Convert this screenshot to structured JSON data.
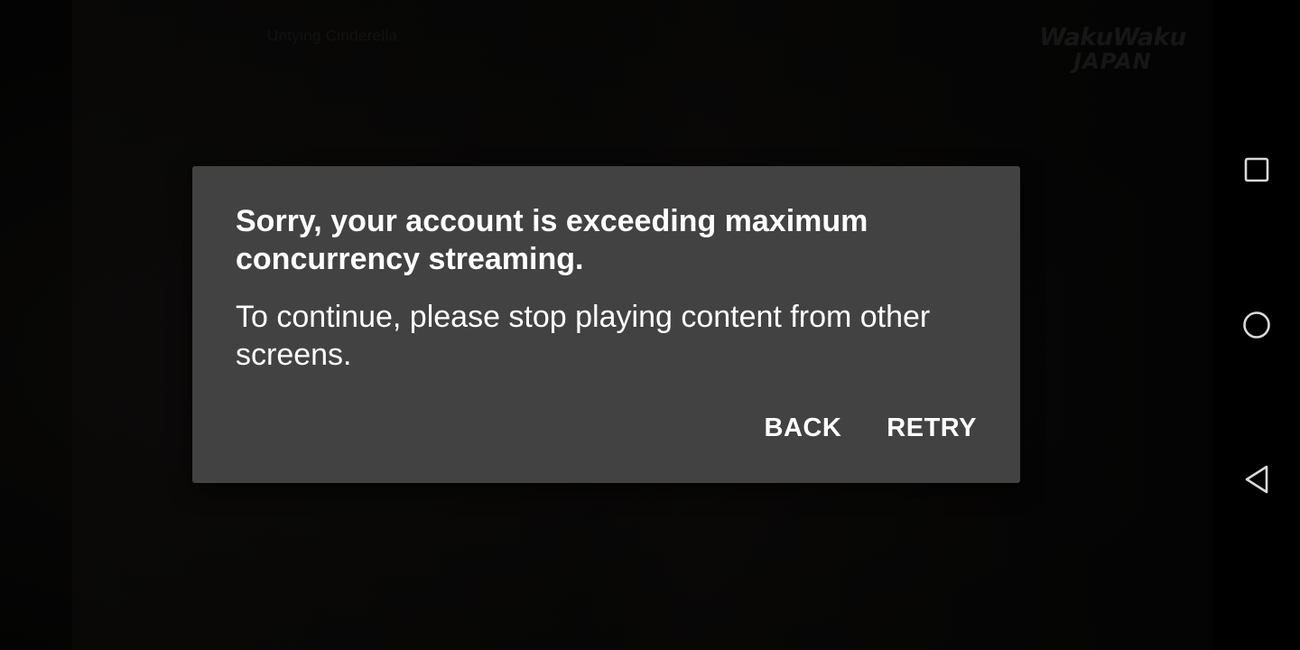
{
  "video": {
    "title": "Untying Cinderella",
    "logo_line1": "WakuWaku",
    "logo_line2": "JAPAN"
  },
  "dialog": {
    "title": "Sorry, your account is exceeding maximum concurrency streaming.",
    "message": "To continue, please stop playing content from other screens.",
    "back_label": "BACK",
    "retry_label": "RETRY",
    "background_color": "#424242",
    "text_color": "#ffffff"
  },
  "system_nav": {
    "icons": [
      "square-icon",
      "circle-icon",
      "triangle-back-icon"
    ],
    "icon_color": "#d9d9d9"
  }
}
